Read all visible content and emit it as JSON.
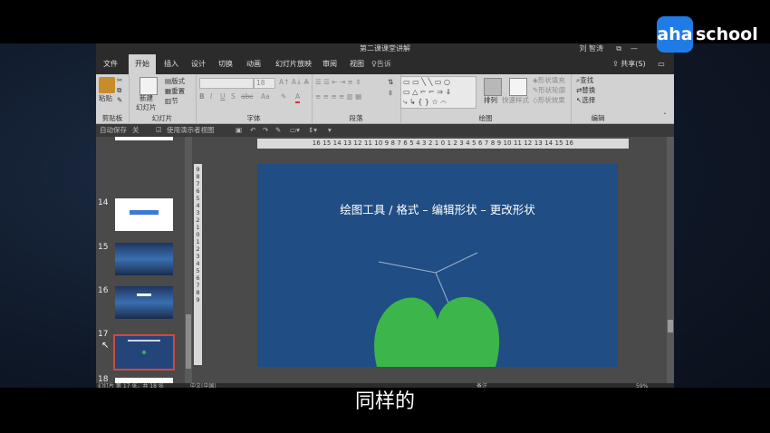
{
  "video": {
    "logo_main": "aha",
    "logo_sub": "school",
    "subtitle": "同样的"
  },
  "window": {
    "title": "第二课课堂讲解",
    "user": "刘 智涛"
  },
  "tabs": [
    {
      "label": "文件"
    },
    {
      "label": "开始"
    },
    {
      "label": "插入"
    },
    {
      "label": "设计"
    },
    {
      "label": "切换"
    },
    {
      "label": "动画"
    },
    {
      "label": "幻灯片放映"
    },
    {
      "label": "审阅"
    },
    {
      "label": "视图"
    }
  ],
  "tell_me": "告诉",
  "share": "共享(S)",
  "ribbon": {
    "clipboard": {
      "paste": "粘贴",
      "label": "剪贴板"
    },
    "slides": {
      "new_slide": "新建",
      "new_slide2": "幻灯片",
      "layout": "版式",
      "reset": "重置",
      "section": "节",
      "label": "幻灯片"
    },
    "font": {
      "size": "18",
      "bold": "B",
      "italic": "I",
      "underline": "U",
      "strike": "S",
      "spacing": "abc",
      "case": "Aa",
      "font_color": "A",
      "label": "字体"
    },
    "paragraph": {
      "label": "段落"
    },
    "drawing": {
      "arrange": "排列",
      "quick_styles": "快速样式",
      "fill": "形状填充",
      "outline": "形状轮廓",
      "effects": "形状效果",
      "label": "绘图"
    },
    "editing": {
      "find": "查找",
      "replace": "替换",
      "select": "选择",
      "label": "编辑"
    }
  },
  "qat": {
    "autosave": "自动保存",
    "off": "关",
    "presenter_view": "使用演示者视图"
  },
  "ruler": {
    "horizontal": "16 15 14 13 12 11 10 9 8 7 6 5 4 3 2 1 0 1 2 3 4 5 6 7 8 9 10 11 12 13 14 15 16",
    "vertical": "9 8 7 6 5 4 3 2 1 0 1 2 3 4 5 6 7 8 9"
  },
  "slides": [
    {
      "num": "14"
    },
    {
      "num": "15"
    },
    {
      "num": "16"
    },
    {
      "num": "17"
    },
    {
      "num": "18"
    }
  ],
  "slide_content": {
    "title": "绘图工具 / 格式 – 编辑形状 – 更改形状",
    "shape_color": "#3cb54a",
    "slide_bg": "#1f4d84"
  },
  "status": {
    "left": "幻灯片 第 17 张，共 18 张",
    "lang": "中文(中国)",
    "notes": "备注",
    "zoom": "59%"
  }
}
